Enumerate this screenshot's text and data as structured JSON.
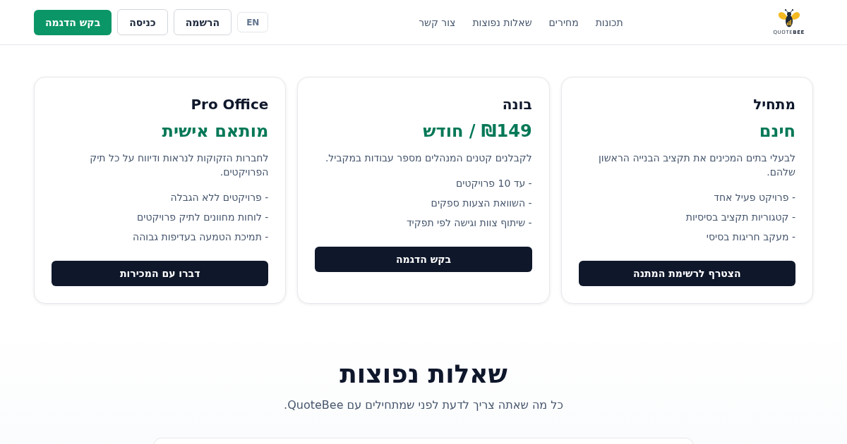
{
  "header": {
    "logo": {
      "text": "QUOTE**BEE**"
    },
    "nav": [
      {
        "label": "תכונות"
      },
      {
        "label": "מחירים"
      },
      {
        "label": "שאלות נפוצות"
      },
      {
        "label": "צור קשר"
      }
    ],
    "actions": [
      {
        "kind": "language",
        "label": "EN"
      },
      {
        "kind": "outline",
        "label": "הרשמה"
      },
      {
        "kind": "outline",
        "label": "כניסה"
      },
      {
        "kind": "primary",
        "label": "בקש הדגמה"
      }
    ]
  },
  "pricing": {
    "plans": [
      {
        "name": "מתחיל",
        "price": "חינם",
        "description": "לבעלי בתים המכינים את תקציב הבנייה הראשון שלהם.",
        "features": [
          "- פרויקט פעיל אחד",
          "- קטגוריות תקציב בסיסיות",
          "- מעקב חריגות בסיסי"
        ],
        "button": "הצטרף לרשימת המתנה"
      },
      {
        "name": "בונה",
        "price": "₪149 / חודש",
        "description": "לקבלנים קטנים המנהלים מספר עבודות במקביל.",
        "features": [
          "- עד 10 פרויקטים",
          "- השוואת הצעות ספקים",
          "- שיתוף צוות וגישה לפי תפקיד"
        ],
        "button": "בקש הדגמה"
      },
      {
        "name": "Pro Office",
        "price": "מותאם אישית",
        "description": "לחברות הזקוקות לנראות ודיווח על כל תיק הפרויקטים.",
        "features": [
          "- פרויקטים ללא הגבלה",
          "- לוחות מחוונים לתיק פרויקטים",
          "- תמיכת הטמעה בעדיפות גבוהה"
        ],
        "button": "דברו עם המכירות"
      }
    ]
  },
  "faq": {
    "title": "שאלות נפוצות",
    "subtitle": "כל מה שאתה צריך לדעת לפני שמתחילים עם QuoteBee."
  }
}
